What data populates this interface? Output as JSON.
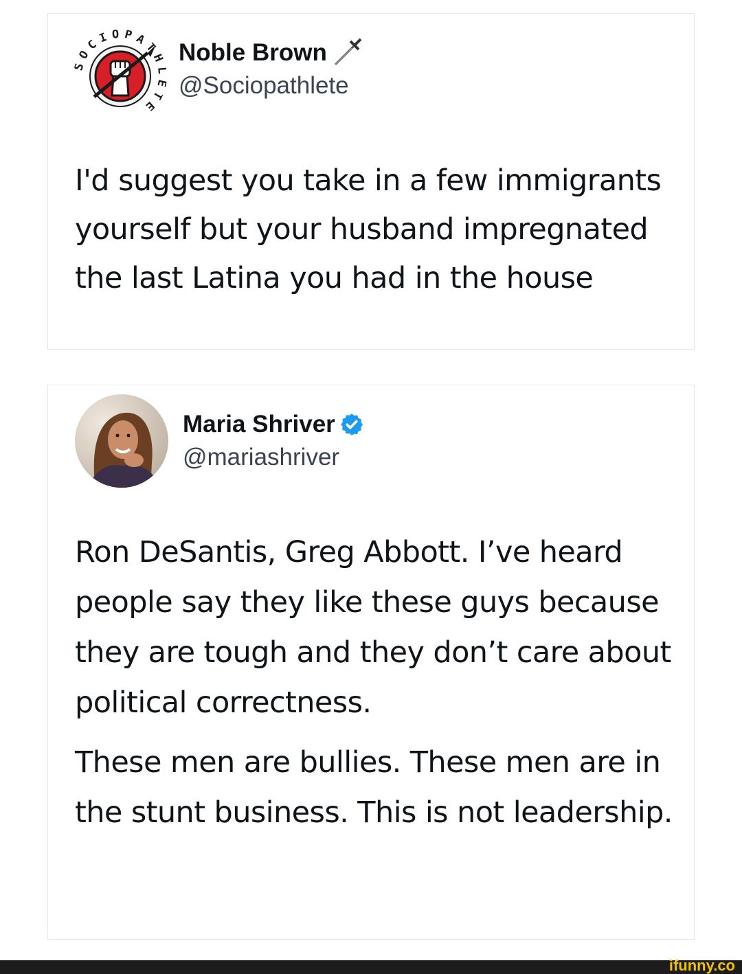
{
  "tweets": [
    {
      "display_name": "Noble Brown",
      "name_emoji": "dagger-icon",
      "handle": "@Sociopathlete",
      "avatar": "sociopathlete-logo",
      "avatar_ring_text": "SOCIOPATHLETE",
      "paragraphs": [
        "I'd suggest you take in a few immigrants yourself but your husband impregnated the last Latina you had in the house"
      ]
    },
    {
      "display_name": "Maria Shriver",
      "verified": true,
      "handle": "@mariashriver",
      "avatar": "profile-photo",
      "paragraphs": [
        "Ron DeSantis, Greg Abbott. I’ve heard people say they like these guys because they are tough and they don’t care about political correctness.",
        "These men are bullies. These men are in the stunt business. This is not leadership."
      ]
    }
  ],
  "watermark": "ifunny.co",
  "colors": {
    "verified_badge": "#1d9bf0",
    "watermark": "#f2c200",
    "footer_bar": "#1c1c1c"
  }
}
